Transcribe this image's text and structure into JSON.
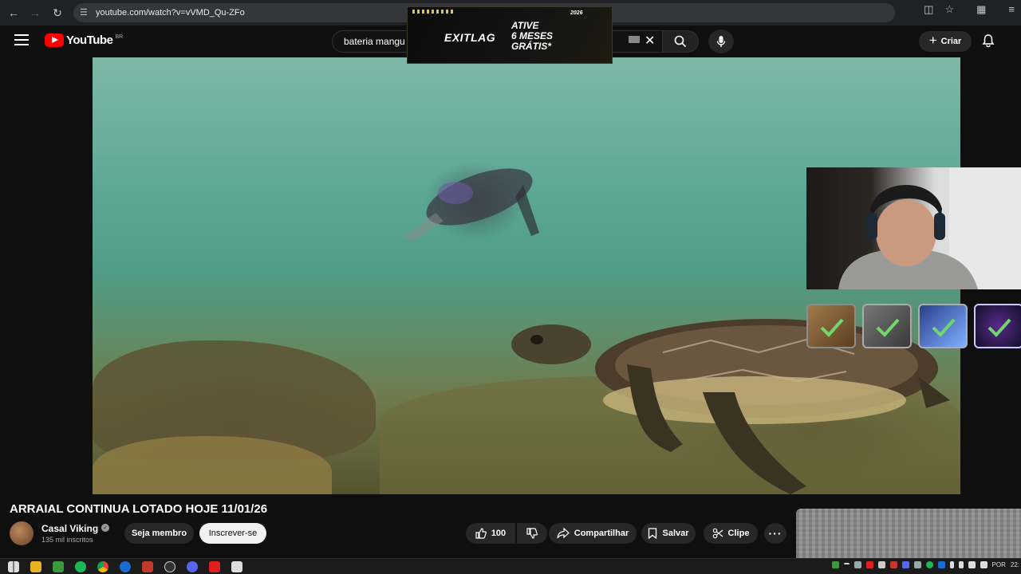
{
  "browser": {
    "url": "youtube.com/watch?v=vVMD_Qu-ZFo",
    "icons": [
      "back-icon",
      "forward-icon",
      "reload-icon",
      "site-info-icon",
      "install-app-icon",
      "bookmark-star-icon",
      "extensions-icon",
      "tab-search-icon"
    ]
  },
  "header": {
    "logo_text": "YouTube",
    "logo_country": "BR",
    "search_value": "bateria mangu",
    "create_label": "Criar"
  },
  "ad": {
    "brand": "EXITLAG",
    "offer_line1": "ATIVE",
    "offer_line2": "6 MESES",
    "offer_line3": "GRÁTIS*",
    "tag": "2026"
  },
  "video": {
    "title": "ARRAIAL CONTINUA LOTADO HOJE 11/01/26"
  },
  "channel": {
    "name": "Casal Viking",
    "subscribers": "135 mil inscritos",
    "member_label": "Seja membro",
    "subscribe_label": "Inscrever-se"
  },
  "actions": {
    "likes": "100",
    "share_label": "Compartilhar",
    "save_label": "Salvar",
    "clip_label": "Clipe"
  },
  "taskbar": {
    "language": "POR",
    "time": "22:"
  },
  "colors": {
    "brand_red": "#ff0000",
    "background": "#0f0f0f",
    "pill": "#272727",
    "accent_green": "#6fd86a"
  }
}
